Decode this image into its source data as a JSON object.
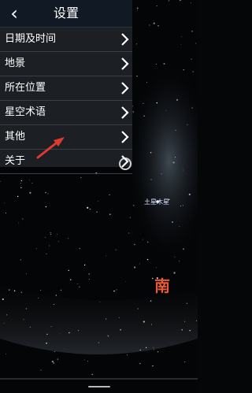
{
  "header": {
    "title": "设置"
  },
  "menu": {
    "items": [
      {
        "label": "日期及时间"
      },
      {
        "label": "地景"
      },
      {
        "label": "所在位置"
      },
      {
        "label": "星空术语"
      },
      {
        "label": "其他"
      },
      {
        "label": "关于"
      }
    ]
  },
  "sky": {
    "object_label": "土星木星",
    "direction_label": "南"
  },
  "colors": {
    "header_bg": "#111a24",
    "panel_bg": "#1c1f24",
    "accent_red": "#e85a35",
    "direction_text": "#e85a35"
  }
}
